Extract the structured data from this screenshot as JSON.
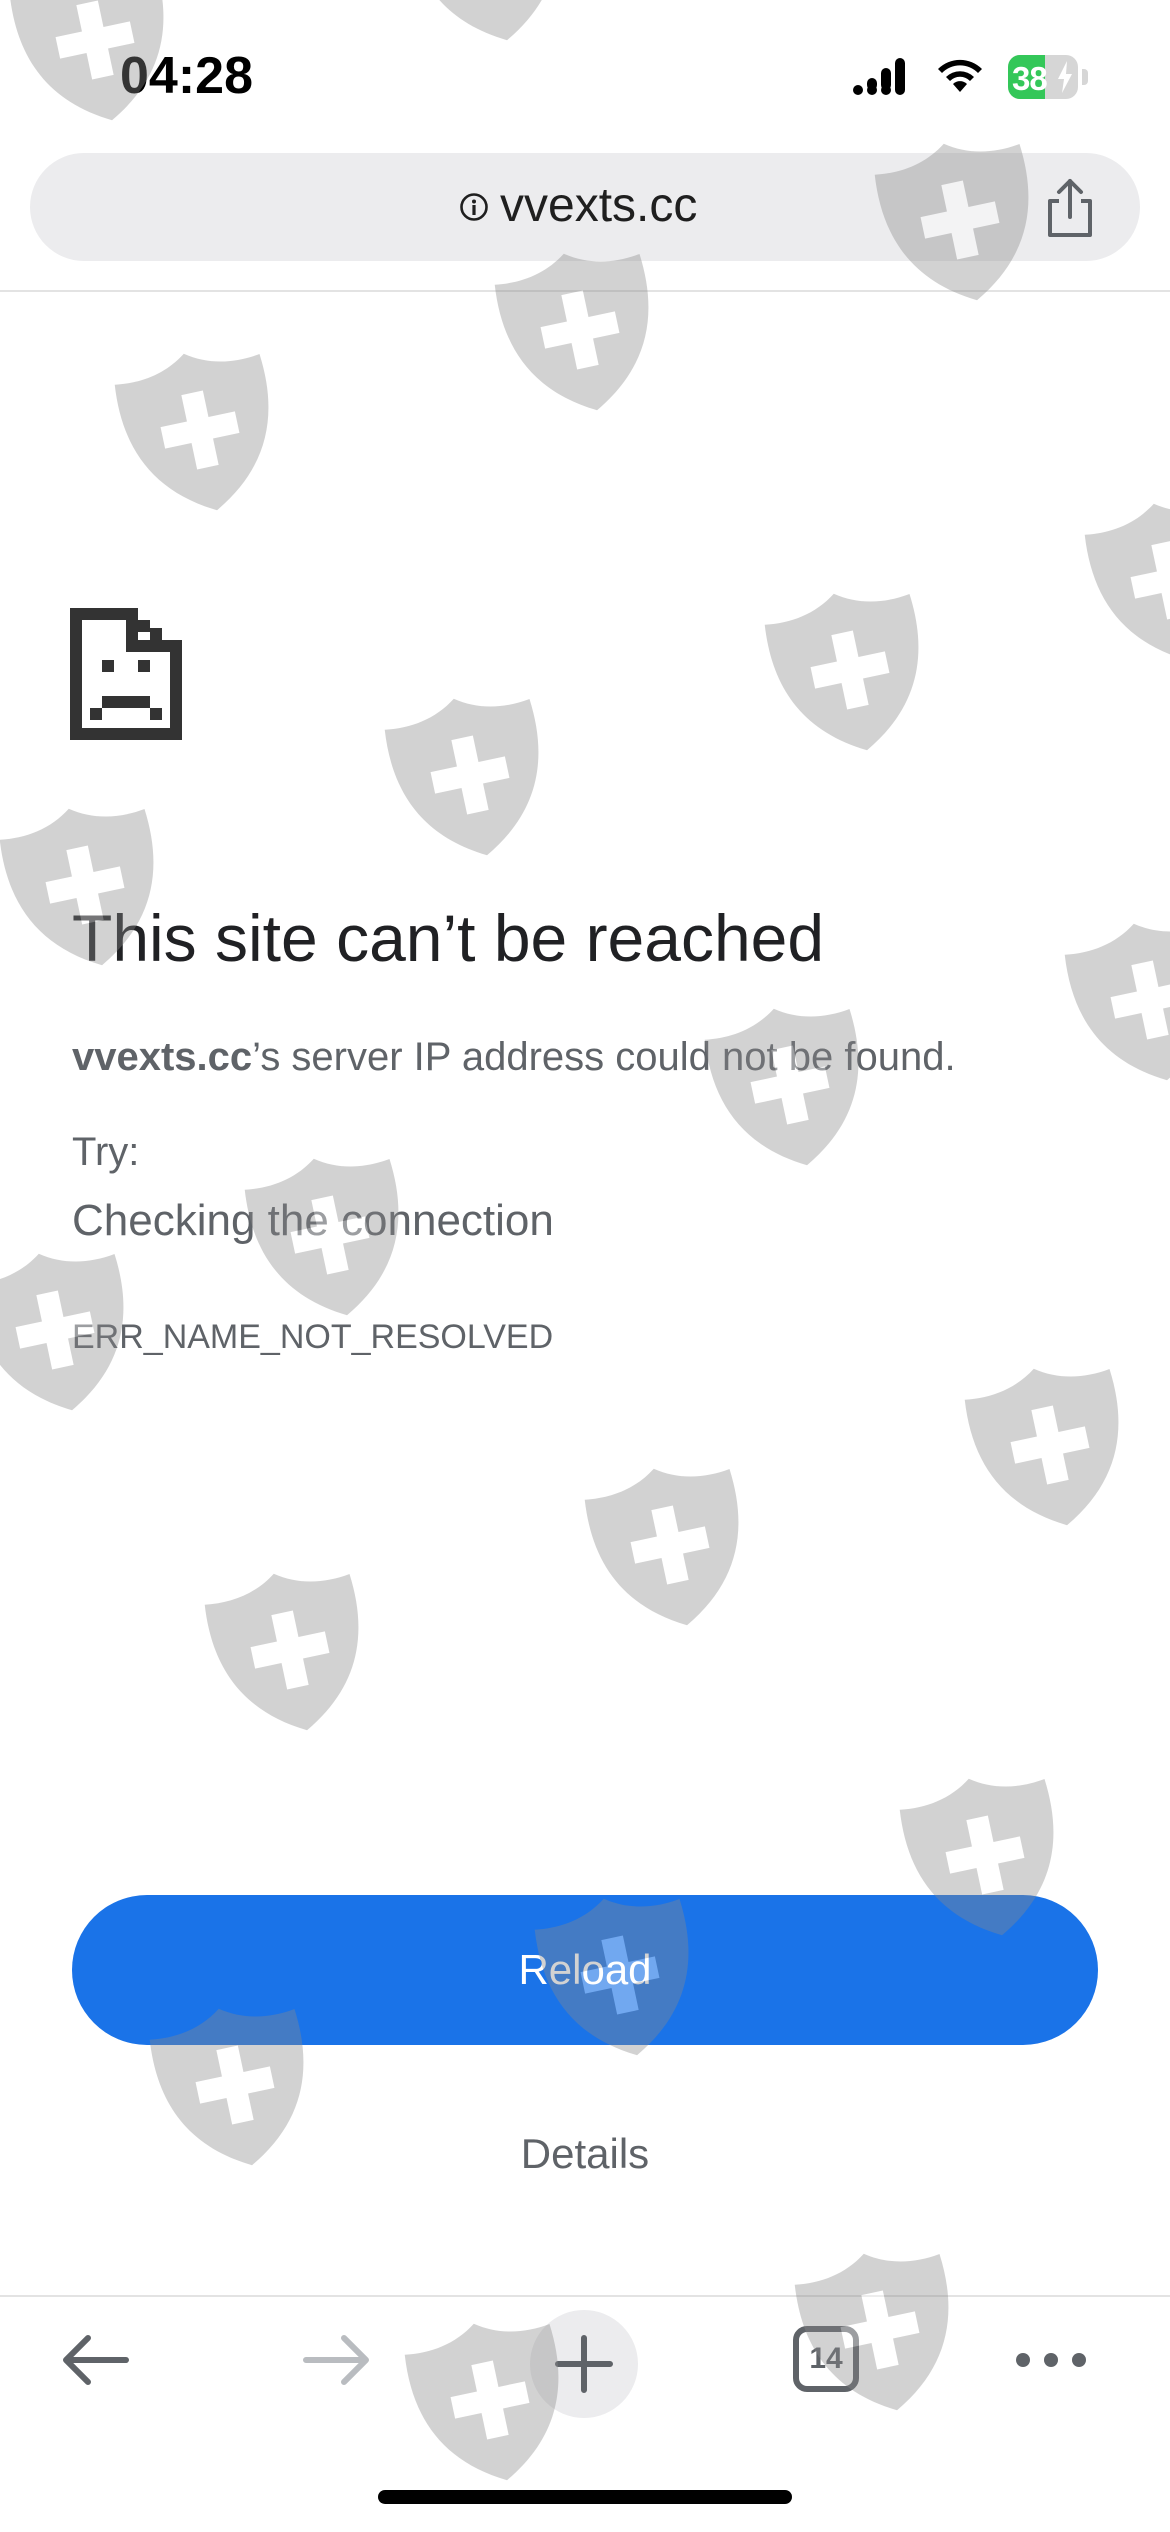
{
  "status_bar": {
    "time": "04:28",
    "battery_level": "38",
    "battery_fraction": 0.38,
    "battery_color": "#34c759"
  },
  "url_bar": {
    "info_icon": "info-icon",
    "url": "vvexts.cc",
    "share_icon": "share-icon"
  },
  "error_page": {
    "icon": "sad-document-icon",
    "title": "This site can’t be reached",
    "description_host": "vvexts.cc",
    "description_rest": "’s server IP address could not be found.",
    "try_label": "Try:",
    "suggestion": "Checking the connection",
    "error_code": "ERR_NAME_NOT_RESOLVED",
    "reload_label": "Reload",
    "details_label": "Details",
    "accent_color": "#1a73e8"
  },
  "toolbar": {
    "back_icon": "arrow-left-icon",
    "forward_icon": "arrow-right-icon",
    "new_tab_icon": "plus-icon",
    "tab_count": "14",
    "menu_icon": "more-horizontal-icon"
  },
  "watermark": {
    "icon": "shield-plus-icon"
  }
}
